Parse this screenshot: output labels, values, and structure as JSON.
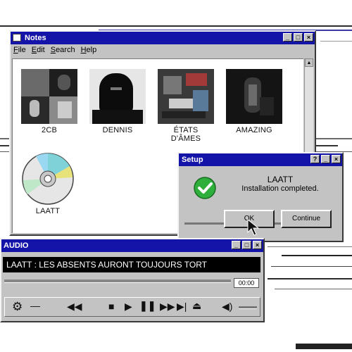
{
  "notes_window": {
    "title": "Notes",
    "menu": [
      "File",
      "Edit",
      "Search",
      "Help"
    ],
    "albums": [
      {
        "label": "2CB"
      },
      {
        "label": "DENNIS"
      },
      {
        "label": "ÉTATS D'ÂMES"
      },
      {
        "label": "AMAZING"
      }
    ],
    "disc_label": "LAATT"
  },
  "setup_dialog": {
    "title": "Setup",
    "heading": "LAATT",
    "message": "Installation completed.",
    "ok_label": "OK",
    "continue_label": "Continue",
    "check_color": "#2eae3a"
  },
  "audio_player": {
    "title": "AUDIO",
    "track": "LAATT : LES ABSENTS AURONT TOUJOURS TORT",
    "time": "00:00",
    "controls": [
      "settings-icon",
      "rewind-icon",
      "stop-icon",
      "play-icon",
      "pause-icon",
      "fast-forward-icon",
      "skip-next-icon",
      "eject-icon",
      "volume-icon"
    ]
  },
  "colors": {
    "title_bar": "#1414a8",
    "window": "#c3c3c3"
  }
}
